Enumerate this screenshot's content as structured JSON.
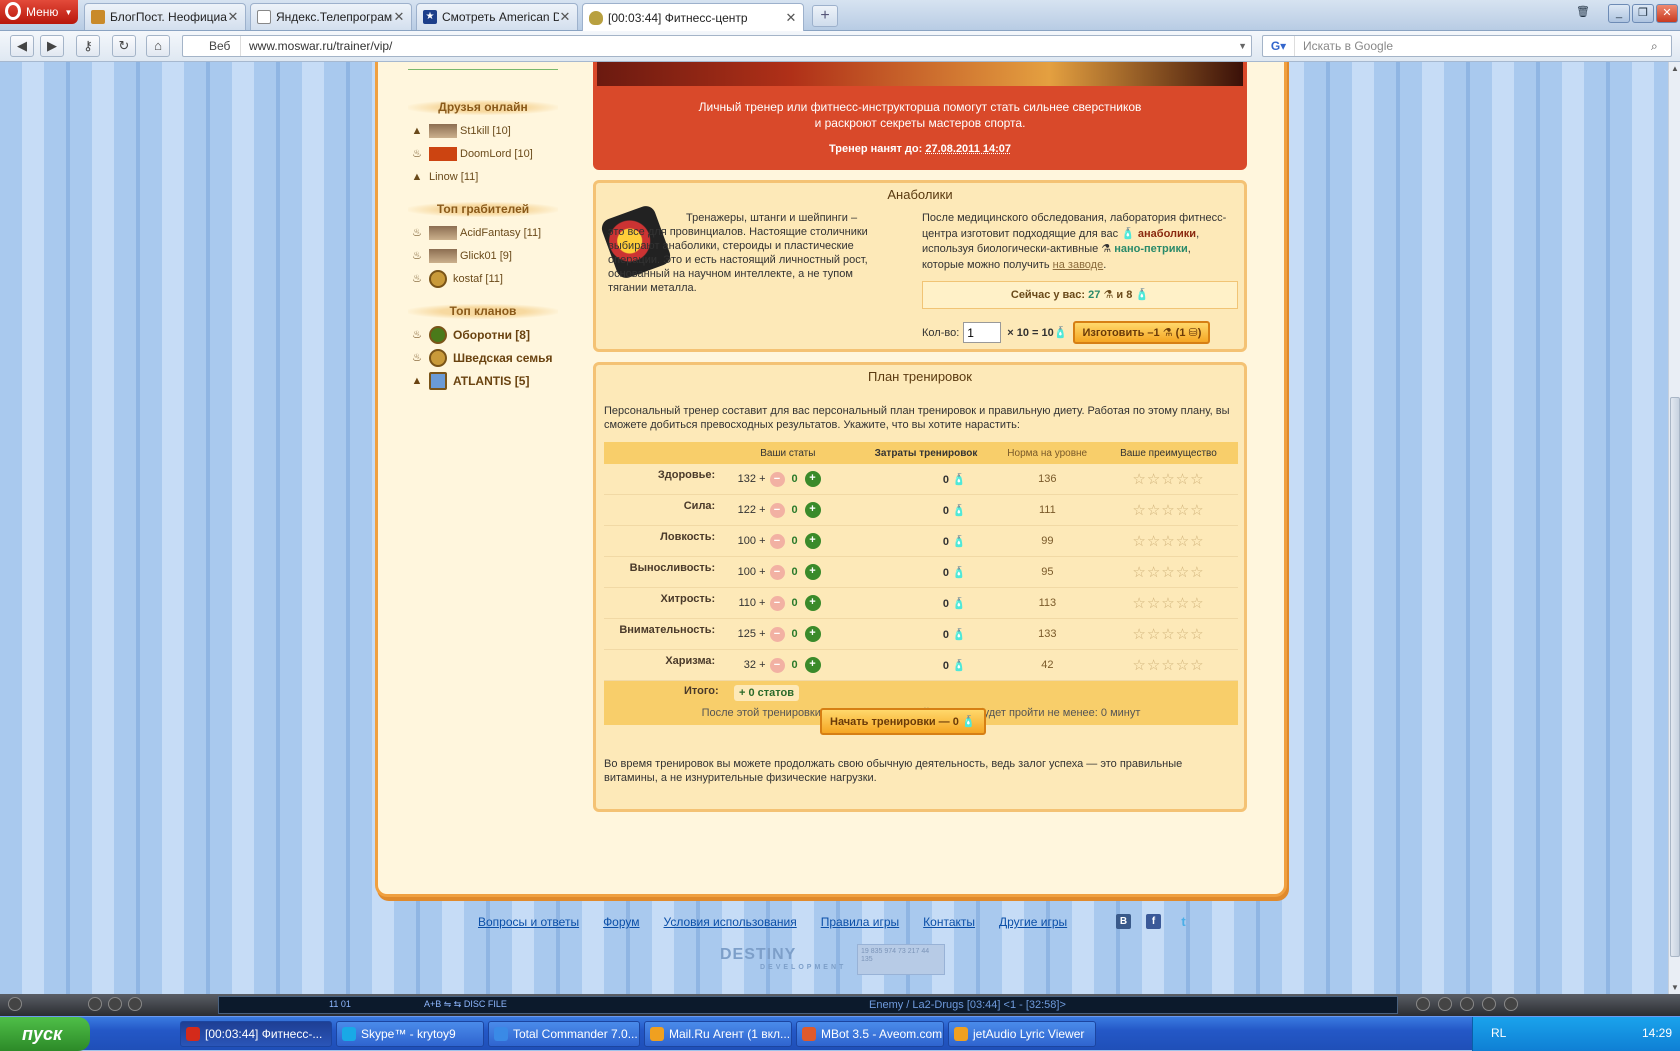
{
  "browser": {
    "menu_label": "Меню",
    "tabs": [
      {
        "title": "БлогПост. Неофициаль...",
        "icon": "blog-favicon"
      },
      {
        "title": "Яндекс.Телепрограмма...",
        "icon": "page-favicon"
      },
      {
        "title": "Смотреть American Dad...",
        "icon": "star-favicon"
      },
      {
        "title": "[00:03:44] Фитнесс-центр",
        "icon": "moswar-favicon"
      }
    ],
    "web_label": "Веб",
    "url": "www.moswar.ru/trainer/vip/",
    "search_placeholder": "Искать в Google"
  },
  "sidebar": {
    "friends_title": "Друзья онлайн",
    "friends": [
      {
        "name": "St1kill [10]",
        "rank": "hat-icon"
      },
      {
        "name": "DoomLord [10]",
        "rank": "onion-icon"
      },
      {
        "name": "Linow [11]",
        "rank": "hat-icon"
      }
    ],
    "robbers_title": "Топ грабителей",
    "robbers": [
      {
        "name": "AcidFantasy [11]"
      },
      {
        "name": "Glick01 [9]"
      },
      {
        "name": "kostaf [11]"
      }
    ],
    "clans_title": "Топ кланов",
    "clans": [
      {
        "name": "Оборотни [8]"
      },
      {
        "name": "Шведская семья"
      },
      {
        "name": "ATLANTIS [5]"
      }
    ]
  },
  "banner": {
    "text_line1": "Личный тренер или фитнесс-инструкторша помогут стать сильнее сверстников",
    "text_line2": "и раскроют секреты мастеров спорта.",
    "hired_label": "Тренер нанят до:",
    "hired_until": "27.08.2011 14:07"
  },
  "anabolics": {
    "title": "Анаболики",
    "left_text": "Тренажеры, штанги и шейпинги – это все для провинциалов. Настоящие столичники выбирают анаболики, стероиды и пластические операции. Это и есть настоящий личностный рост, основанный на научном интеллекте, а не тупом тягании металла.",
    "right_text_1": "После медицинского обследования, лаборатория фитнесс-центра изготовит подходящие для вас",
    "anabolics_word": "анаболики",
    "right_text_2": ", используя биологически-активные",
    "nano_word": "нано-петрики",
    "right_text_3": ", которые можно получить",
    "factory_link": "на заводе",
    "have_label": "Сейчас у вас:",
    "have_nano": "27",
    "have_and": "и",
    "have_anab": "8",
    "qty_label": "Кол-во:",
    "qty_value": "1",
    "qty_formula": "× 10 = 10",
    "make_button": "Изготовить –1",
    "make_cost": "(1"
  },
  "plan": {
    "title": "План тренировок",
    "intro": "Персональный тренер составит для вас персональный план тренировок и правильную диету. Работая по этому плану, вы сможете добиться превосходных результатов. Укажите, что вы хотите нарастить:",
    "headers": [
      "Ваши статы",
      "Затраты тренировок",
      "Норма на уровне",
      "Ваше преимущество"
    ],
    "rows": [
      {
        "name": "Здоровье:",
        "value": "132 +",
        "add": "0",
        "cost": "0",
        "norm": "136",
        "stars": 0
      },
      {
        "name": "Сила:",
        "value": "122 +",
        "add": "0",
        "cost": "0",
        "norm": "111",
        "stars": 0
      },
      {
        "name": "Ловкость:",
        "value": "100 +",
        "add": "0",
        "cost": "0",
        "norm": "99",
        "stars": 0
      },
      {
        "name": "Выносливость:",
        "value": "100 +",
        "add": "0",
        "cost": "0",
        "norm": "95",
        "stars": 0
      },
      {
        "name": "Хитрость:",
        "value": "110 +",
        "add": "0",
        "cost": "0",
        "norm": "113",
        "stars": 0
      },
      {
        "name": "Внимательность:",
        "value": "125 +",
        "add": "0",
        "cost": "0",
        "norm": "133",
        "stars": 0
      },
      {
        "name": "Харизма:",
        "value": "32 +",
        "add": "0",
        "cost": "0",
        "norm": "42",
        "stars": 0
      }
    ],
    "total_label": "Итого:",
    "total_value": "+ 0 статов",
    "total_note": "После этой тренировки (и перед следующей) должно будет пройти не менее: 0 минут",
    "start_button": "Начать тренировки — 0",
    "outro": "Во время тренировок вы можете продолжать свою обычную деятельность, ведь залог успеха — это правильные витамины, а не изнурительные физические нагрузки."
  },
  "footer": {
    "links": [
      "Вопросы и ответы",
      "Форум",
      "Условия использования",
      "Правила игры",
      "Контакты",
      "Другие игры"
    ],
    "social": [
      "В",
      "f",
      "t"
    ],
    "destiny": "DESTINY",
    "destiny_sub": "DEVELOPMENT",
    "counter_text": "19 835 974 73 217 44 135"
  },
  "player": {
    "track_info": "11   01",
    "mode": "A+B  ⇋  ⇆  DISC  FILE",
    "song": "Enemy / La2-Drugs  [03:44]   <1 - [32:58]>"
  },
  "taskbar": {
    "start_label": "пуск",
    "items": [
      {
        "label": "[00:03:44] Фитнесс-...",
        "color": "#d42a1a"
      },
      {
        "label": "Skype™ - krytoy9",
        "color": "#19a9e6"
      },
      {
        "label": "Total Commander 7.0...",
        "color": "#3a8ae6"
      },
      {
        "label": "Mail.Ru Агент (1 вкл...",
        "color": "#f0a020"
      },
      {
        "label": "MBot 3.5 - Aveom.com",
        "color": "#e05a2a"
      },
      {
        "label": "jetAudio Lyric Viewer",
        "color": "#f0a020"
      }
    ],
    "lang": "RL",
    "clock": "14:29"
  },
  "colors": {
    "accent": "#f0a040",
    "banner": "#d9492a",
    "block_bg": "#fde9b8",
    "header_row": "#f8ce6a"
  }
}
